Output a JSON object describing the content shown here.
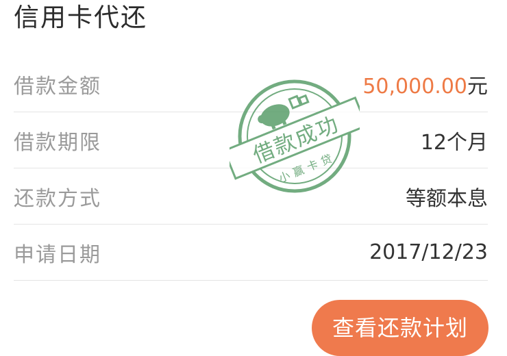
{
  "header": {
    "title": "信用卡代还"
  },
  "details": {
    "amount": {
      "label": "借款金额",
      "value": "50,000.00",
      "unit": "元"
    },
    "term": {
      "label": "借款期限",
      "value": "12个月"
    },
    "method": {
      "label": "还款方式",
      "value": "等额本息"
    },
    "date": {
      "label": "申请日期",
      "value": "2017/12/23"
    }
  },
  "stamp": {
    "main_text": "借款成功",
    "sub_text": "小赢卡贷",
    "icon": "piggy-bank-icon",
    "color": "#5a9e6a"
  },
  "actions": {
    "view_plan_label": "查看还款计划"
  },
  "colors": {
    "accent": "#ef7a4d",
    "amount": "#ee7a45",
    "stamp": "#5a9e6a"
  }
}
